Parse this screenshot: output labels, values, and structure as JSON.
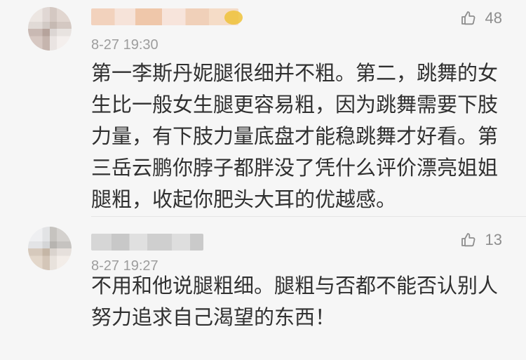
{
  "comments": [
    {
      "timestamp": "8-27 19:30",
      "likes": "48",
      "content_lines": [
        "第一李斯丹妮腿很细并不粗。第二，跳舞的女",
        "生比一般女生腿更容易粗，因为跳舞需要下肢",
        "力量，有下肢力量底盘才能稳跳舞才好看。第",
        "三岳云鹏你脖子都胖没了凭什么评价漂亮姐姐",
        "腿粗，收起你肥头大耳的优越感。"
      ],
      "icons": {
        "avatar": "blurred-avatar",
        "badge": "badge-icon",
        "like": "thumbs-up-icon"
      }
    },
    {
      "timestamp": "8-27 19:27",
      "likes": "13",
      "content_lines": [
        "不用和他说腿粗细。腿粗与否都不能否认别人",
        "努力追求自己渴望的东西！"
      ],
      "icons": {
        "avatar": "blurred-avatar",
        "like": "thumbs-up-icon"
      }
    }
  ],
  "colors": {
    "background": "#f6f6f6",
    "text": "#303030",
    "muted": "#9d9d9d",
    "icon": "#8e8e8e",
    "divider": "#e5e5e5"
  }
}
